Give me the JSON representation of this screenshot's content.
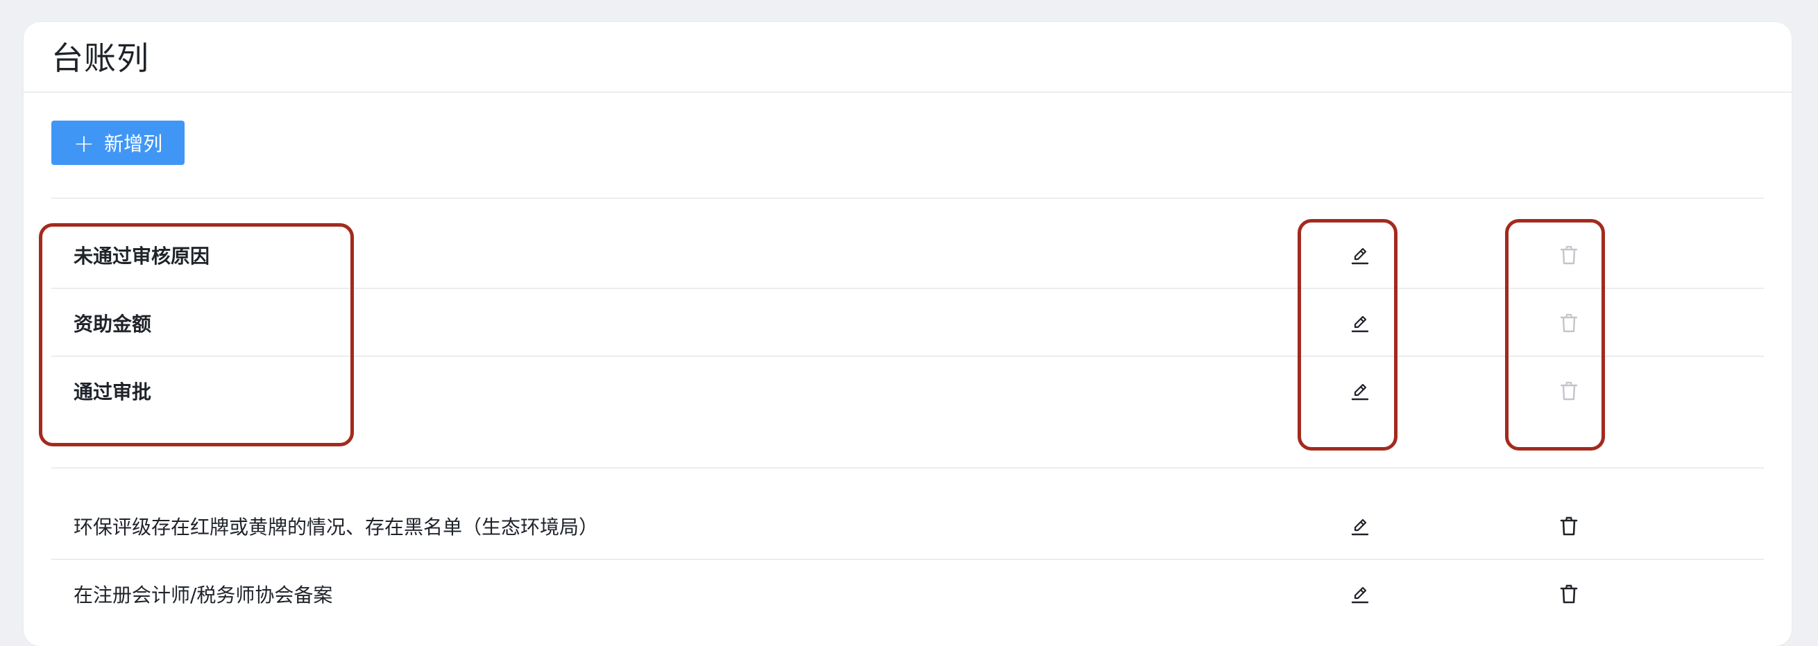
{
  "header": {
    "title": "台账列"
  },
  "toolbar": {
    "add_label": "新增列",
    "add_icon": "plus-icon",
    "accent_color": "#4096f5"
  },
  "system_rows": [
    {
      "label": "未通过审核原因",
      "edit_icon": "edit-pen-icon",
      "delete_icon": "trash-icon",
      "delete_disabled": true
    },
    {
      "label": "资助金额",
      "edit_icon": "edit-pen-icon",
      "delete_icon": "trash-icon",
      "delete_disabled": true
    },
    {
      "label": "通过审批",
      "edit_icon": "edit-pen-icon",
      "delete_icon": "trash-icon",
      "delete_disabled": true
    }
  ],
  "custom_rows": [
    {
      "label": "环保评级存在红牌或黄牌的情况、存在黑名单（生态环境局）",
      "edit_icon": "edit-pen-icon",
      "delete_icon": "trash-icon",
      "delete_disabled": false
    },
    {
      "label": "在注册会计师/税务师协会备案",
      "edit_icon": "edit-pen-icon",
      "delete_icon": "trash-icon",
      "delete_disabled": false
    }
  ],
  "highlight_color": "#a32a1e"
}
